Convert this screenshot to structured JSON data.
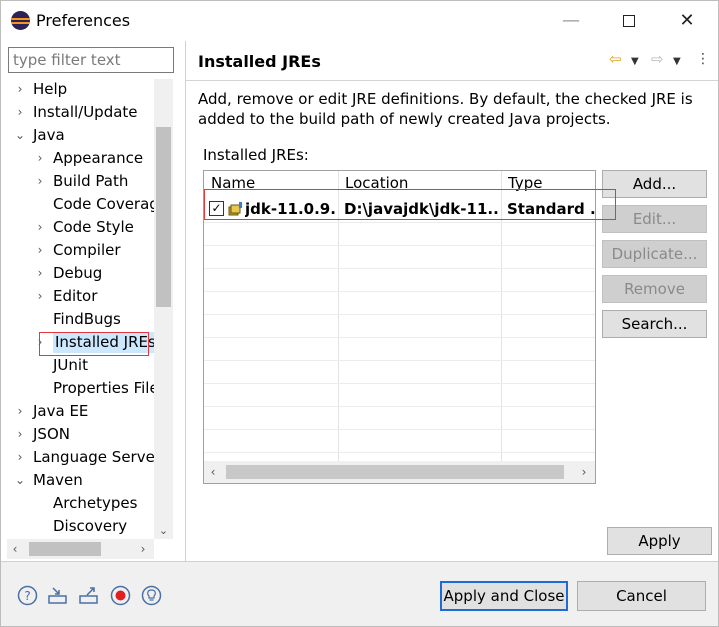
{
  "window": {
    "title": "Preferences",
    "minimize": "—",
    "close": "✕"
  },
  "filter": {
    "placeholder": "type filter text"
  },
  "tree": [
    {
      "label": "Help",
      "twisty": "›"
    },
    {
      "label": "Install/Update",
      "twisty": "›"
    },
    {
      "label": "Java",
      "twisty": "⌄"
    },
    {
      "label": "Appearance",
      "twisty": "›"
    },
    {
      "label": "Build Path",
      "twisty": "›"
    },
    {
      "label": "Code Coverag",
      "twisty": ""
    },
    {
      "label": "Code Style",
      "twisty": "›"
    },
    {
      "label": "Compiler",
      "twisty": "›"
    },
    {
      "label": "Debug",
      "twisty": "›"
    },
    {
      "label": "Editor",
      "twisty": "›"
    },
    {
      "label": "FindBugs",
      "twisty": ""
    },
    {
      "label": "Installed JREs",
      "twisty": "›",
      "selected": true
    },
    {
      "label": "JUnit",
      "twisty": ""
    },
    {
      "label": "Properties File",
      "twisty": ""
    },
    {
      "label": "Java EE",
      "twisty": "›"
    },
    {
      "label": "JSON",
      "twisty": "›"
    },
    {
      "label": "Language Server",
      "twisty": "›"
    },
    {
      "label": "Maven",
      "twisty": "⌄"
    },
    {
      "label": "Archetypes",
      "twisty": ""
    },
    {
      "label": "Discovery",
      "twisty": ""
    }
  ],
  "page": {
    "title": "Installed JREs",
    "description": "Add, remove or edit JRE definitions. By default, the checked JRE is added to the build path of newly created Java projects.",
    "list_label": "Installed JREs:",
    "columns": [
      "Name",
      "Location",
      "Type"
    ],
    "rows": [
      {
        "checked": true,
        "name": "jdk-11.0.9...",
        "location": "D:\\javajdk\\jdk-11...",
        "type": "Standard ..."
      }
    ],
    "buttons": {
      "add": "Add...",
      "edit": "Edit...",
      "duplicate": "Duplicate...",
      "remove": "Remove",
      "search": "Search..."
    },
    "apply": "Apply"
  },
  "footer": {
    "apply_and_close": "Apply and Close",
    "cancel": "Cancel",
    "icons": [
      "help-icon",
      "import-icon",
      "export-icon",
      "record-icon",
      "tip-icon"
    ]
  },
  "colors": {
    "highlight_border": "#e4383a",
    "default_button_border": "#1d6bd6",
    "nav_back": "#e0a020"
  }
}
